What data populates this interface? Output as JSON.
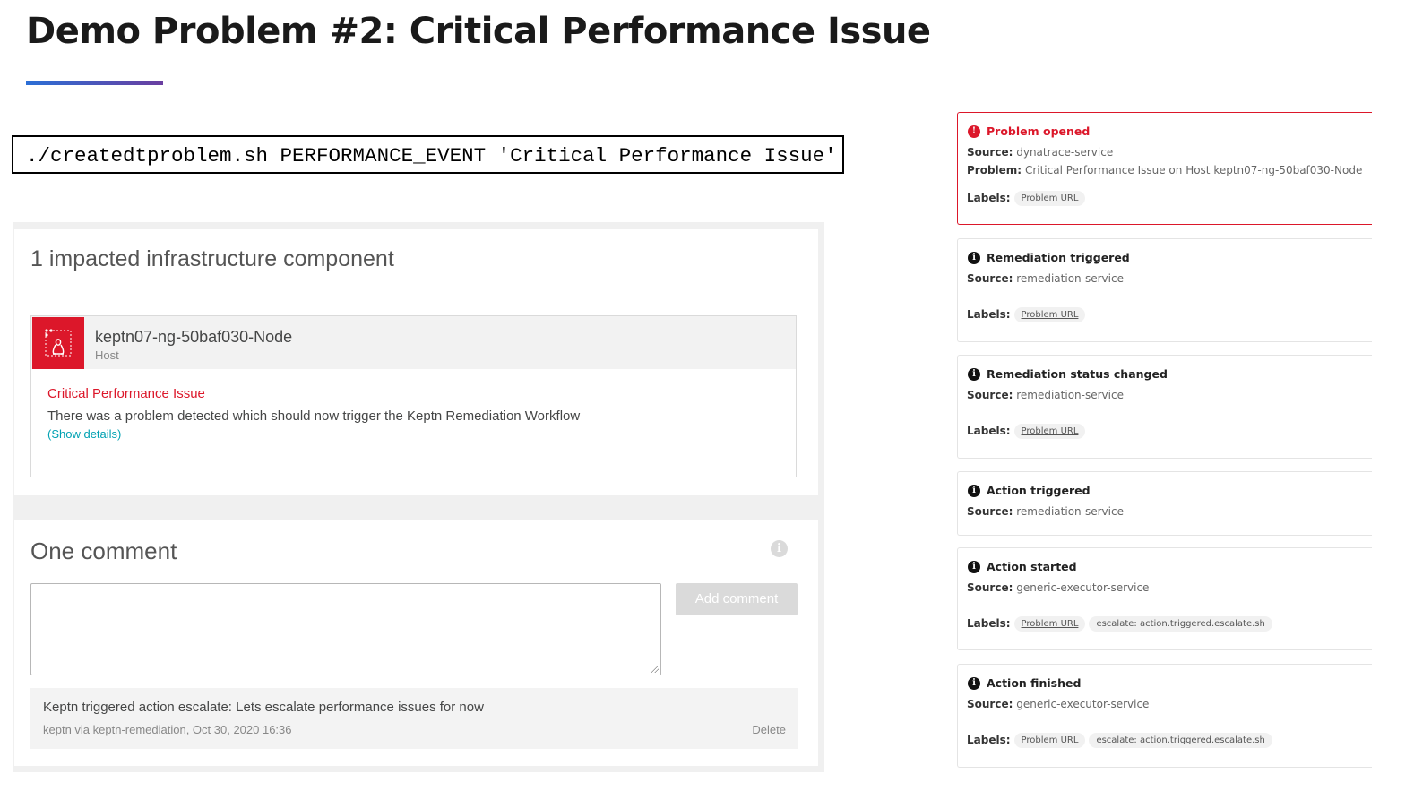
{
  "slide": {
    "title": "Demo Problem #2: Critical Performance Issue",
    "command": "./createdtproblem.sh PERFORMANCE_EVENT 'Critical Performance Issue'"
  },
  "impact_card": {
    "title": "1 impacted infrastructure component",
    "component": {
      "name": "keptn07-ng-50baf030-Node",
      "type": "Host",
      "issue_title": "Critical Performance Issue",
      "issue_description": "There was a problem detected which should now trigger the Keptn Remediation Workflow",
      "show_details": "(Show details)"
    }
  },
  "comments_card": {
    "title": "One comment",
    "input_value": "",
    "add_button": "Add comment",
    "comment": {
      "text": "Keptn triggered action escalate: Lets escalate performance issues for now",
      "meta": "keptn via keptn-remediation, Oct 30, 2020 16:36",
      "delete": "Delete"
    }
  },
  "events": [
    {
      "title": "Problem opened",
      "source_label": "Source:",
      "source": "dynatrace-service",
      "problem_label": "Problem:",
      "problem": "Critical Performance Issue on Host keptn07-ng-50baf030-Node",
      "labels_label": "Labels:",
      "chips": [
        "Problem URL"
      ]
    },
    {
      "title": "Remediation triggered",
      "source_label": "Source:",
      "source": "remediation-service",
      "labels_label": "Labels:",
      "chips": [
        "Problem URL"
      ]
    },
    {
      "title": "Remediation status changed",
      "source_label": "Source:",
      "source": "remediation-service",
      "labels_label": "Labels:",
      "chips": [
        "Problem URL"
      ]
    },
    {
      "title": "Action triggered",
      "source_label": "Source:",
      "source": "remediation-service"
    },
    {
      "title": "Action started",
      "source_label": "Source:",
      "source": "generic-executor-service",
      "labels_label": "Labels:",
      "chips": [
        "Problem URL",
        "escalate: action.triggered.escalate.sh"
      ]
    },
    {
      "title": "Action finished",
      "source_label": "Source:",
      "source": "generic-executor-service",
      "labels_label": "Labels:",
      "chips": [
        "Problem URL",
        "escalate: action.triggered.escalate.sh"
      ]
    }
  ],
  "colors": {
    "error": "#dc172a",
    "link": "#00a1b2",
    "accent_start": "#2b6fd6",
    "accent_end": "#6a3ea0"
  },
  "icons": {
    "host": "linux-tux-icon",
    "error": "exclamation-circle-icon",
    "info": "info-circle-icon"
  }
}
